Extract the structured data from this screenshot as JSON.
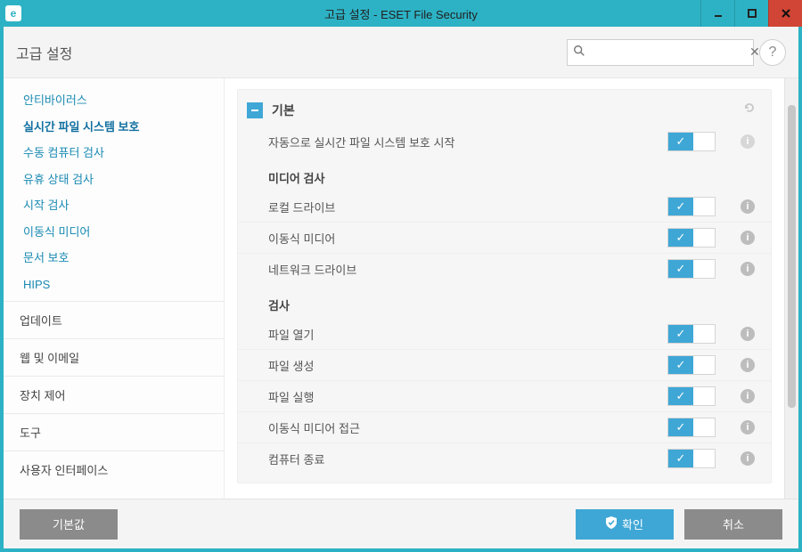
{
  "window": {
    "title": "고급 설정 - ESET File Security",
    "app_glyph": "e"
  },
  "header": {
    "title": "고급 설정",
    "search_placeholder": ""
  },
  "sidebar": {
    "nav": [
      {
        "label": "안티바이러스",
        "selected": false
      },
      {
        "label": "실시간 파일 시스템 보호",
        "selected": true
      },
      {
        "label": "수동 컴퓨터 검사",
        "selected": false
      },
      {
        "label": "유휴 상태 검사",
        "selected": false
      },
      {
        "label": "시작 검사",
        "selected": false
      },
      {
        "label": "이동식 미디어",
        "selected": false
      },
      {
        "label": "문서 보호",
        "selected": false
      },
      {
        "label": "HIPS",
        "selected": false
      }
    ],
    "categories": [
      {
        "label": "업데이트"
      },
      {
        "label": "웹 및 이메일"
      },
      {
        "label": "장치 제어"
      },
      {
        "label": "도구"
      },
      {
        "label": "사용자 인터페이스"
      }
    ]
  },
  "content": {
    "group_title": "기본",
    "sections": [
      {
        "title": null,
        "rows": [
          {
            "label": "자동으로 실시간 파일 시스템 보호 시작",
            "on": true,
            "info": "light"
          }
        ]
      },
      {
        "title": "미디어 검사",
        "rows": [
          {
            "label": "로컬 드라이브",
            "on": true,
            "info": "normal"
          },
          {
            "label": "이동식 미디어",
            "on": true,
            "info": "normal"
          },
          {
            "label": "네트워크 드라이브",
            "on": true,
            "info": "normal"
          }
        ]
      },
      {
        "title": "검사",
        "rows": [
          {
            "label": "파일 열기",
            "on": true,
            "info": "normal"
          },
          {
            "label": "파일 생성",
            "on": true,
            "info": "normal"
          },
          {
            "label": "파일 실행",
            "on": true,
            "info": "normal"
          },
          {
            "label": "이동식 미디어 접근",
            "on": true,
            "info": "normal"
          },
          {
            "label": "컴퓨터 종료",
            "on": true,
            "info": "normal"
          }
        ]
      }
    ]
  },
  "footer": {
    "default_label": "기본값",
    "ok_label": "확인",
    "cancel_label": "취소"
  }
}
